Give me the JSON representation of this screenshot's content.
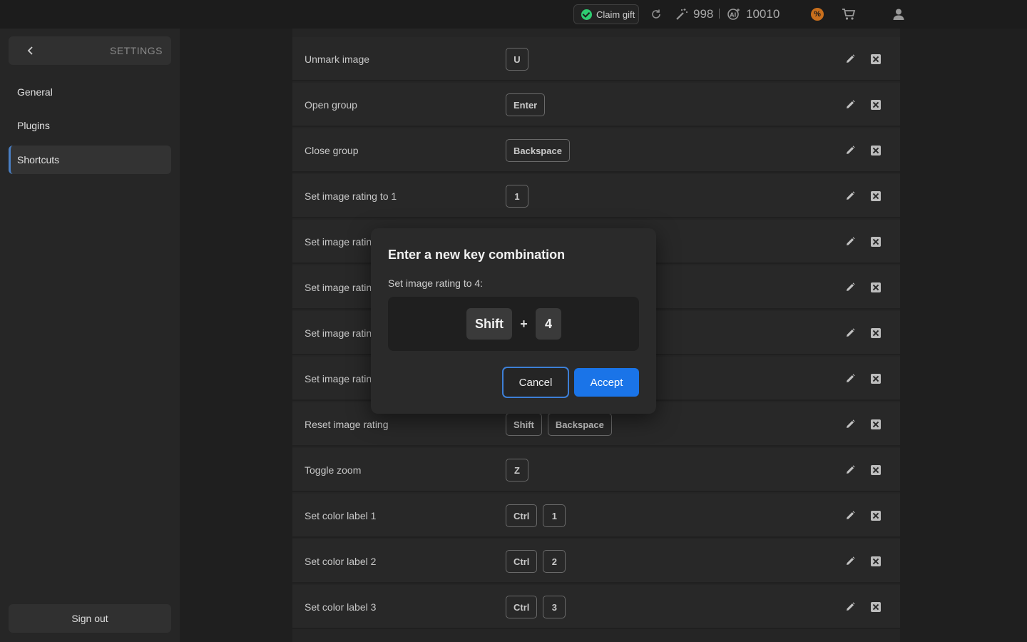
{
  "topbar": {
    "claim_gift": "Claim gift",
    "credits_1": "998",
    "credits_2": "10010",
    "icons": [
      "check-circle-icon",
      "refresh-icon",
      "magic-wand-icon",
      "ai-icon",
      "discount-badge-icon",
      "cart-icon",
      "user-icon"
    ],
    "colors": {
      "gift_check": "#2ecc71",
      "discount_badge": "#c96f1c"
    }
  },
  "sidebar": {
    "back_icon": "chevron-left-icon",
    "title": "SETTINGS",
    "items": [
      {
        "label": "General",
        "active": false
      },
      {
        "label": "Plugins",
        "active": false
      },
      {
        "label": "Shortcuts",
        "active": true
      }
    ],
    "sign_out": "Sign out"
  },
  "shortcuts": [
    {
      "label": "Unmark image",
      "keys": [
        "U"
      ]
    },
    {
      "label": "Open group",
      "keys": [
        "Enter"
      ]
    },
    {
      "label": "Close group",
      "keys": [
        "Backspace"
      ]
    },
    {
      "label": "Set image rating to 1",
      "keys": [
        "1"
      ]
    },
    {
      "label": "Set image ratin",
      "keys": []
    },
    {
      "label": "Set image ratin",
      "keys": []
    },
    {
      "label": "Set image ratin",
      "keys": []
    },
    {
      "label": "Set image ratin",
      "keys": []
    },
    {
      "label": "Reset image rating",
      "keys": [
        "Shift",
        "Backspace"
      ]
    },
    {
      "label": "Toggle zoom",
      "keys": [
        "Z"
      ]
    },
    {
      "label": "Set color label 1",
      "keys": [
        "Ctrl",
        "1"
      ]
    },
    {
      "label": "Set color label 2",
      "keys": [
        "Ctrl",
        "2"
      ]
    },
    {
      "label": "Set color label 3",
      "keys": [
        "Ctrl",
        "3"
      ]
    }
  ],
  "row_icons": {
    "edit": "pencil-icon",
    "delete": "close-box-icon"
  },
  "modal": {
    "title": "Enter a new key combination",
    "subtitle": "Set image rating to 4:",
    "combo": {
      "key1": "Shift",
      "plus": "+",
      "key2": "4"
    },
    "cancel": "Cancel",
    "accept": "Accept",
    "colors": {
      "accept_bg": "#1a74e8",
      "cancel_border": "#3d7fd6"
    }
  }
}
